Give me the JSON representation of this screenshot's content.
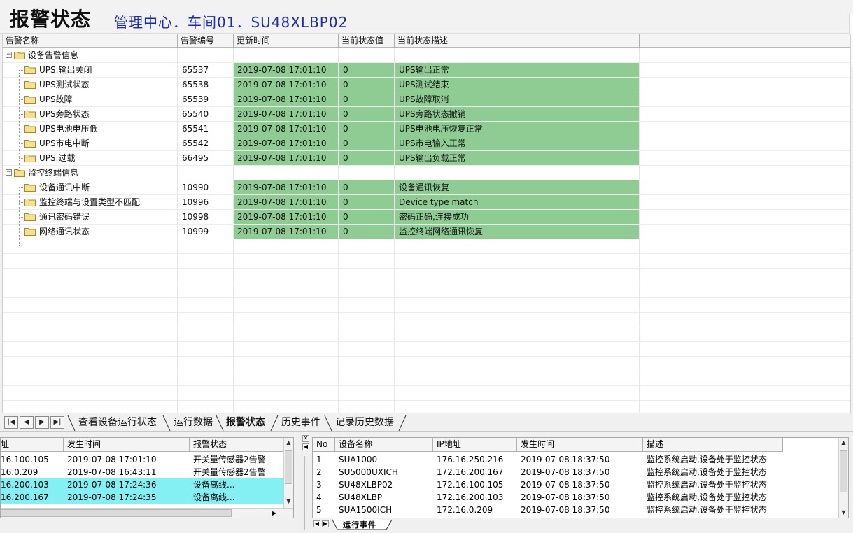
{
  "header": {
    "title": "报警状态",
    "path": "管理中心．车间01．SU48XLBP02"
  },
  "table": {
    "columns": [
      "告警名称",
      "告警编号",
      "更新时间",
      "当前状态值",
      "当前状态描述"
    ],
    "groups": [
      {
        "name": "设备告警信息",
        "rows": [
          {
            "name": "UPS.输出关闭",
            "code": "65537",
            "time": "2019-07-08 17:01:10",
            "value": "0",
            "desc": "UPS输出正常"
          },
          {
            "name": "UPS测试状态",
            "code": "65538",
            "time": "2019-07-08 17:01:10",
            "value": "0",
            "desc": "UPS测试结束"
          },
          {
            "name": "UPS故障",
            "code": "65539",
            "time": "2019-07-08 17:01:10",
            "value": "0",
            "desc": "UPS故障取消"
          },
          {
            "name": "UPS旁路状态",
            "code": "65540",
            "time": "2019-07-08 17:01:10",
            "value": "0",
            "desc": "UPS旁路状态撤销"
          },
          {
            "name": "UPS电池电压低",
            "code": "65541",
            "time": "2019-07-08 17:01:10",
            "value": "0",
            "desc": "UPS电池电压恢复正常"
          },
          {
            "name": "UPS市电中断",
            "code": "65542",
            "time": "2019-07-08 17:01:10",
            "value": "0",
            "desc": "UPS市电输入正常"
          },
          {
            "name": "UPS.过载",
            "code": "66495",
            "time": "2019-07-08 17:01:10",
            "value": "0",
            "desc": "UPS输出负载正常"
          }
        ]
      },
      {
        "name": "监控终端信息",
        "rows": [
          {
            "name": "设备通讯中断",
            "code": "10990",
            "time": "2019-07-08 17:01:10",
            "value": "0",
            "desc": "设备通讯恢复"
          },
          {
            "name": "监控终端与设置类型不匹配",
            "code": "10996",
            "time": "2019-07-08 17:01:10",
            "value": "0",
            "desc": "Device type match"
          },
          {
            "name": "通讯密码错误",
            "code": "10998",
            "time": "2019-07-08 17:01:10",
            "value": "0",
            "desc": "密码正确,连接成功"
          },
          {
            "name": "网络通讯状态",
            "code": "10999",
            "time": "2019-07-08 17:01:10",
            "value": "0",
            "desc": "监控终端网络通讯恢复"
          }
        ]
      }
    ],
    "status_color": "#8fcc94"
  },
  "tabs": {
    "nav": [
      "first-icon",
      "prev-icon",
      "next-icon",
      "last-icon"
    ],
    "items": [
      "查看设备运行状态",
      "运行数据",
      "报警状态",
      "历史事件",
      "记录历史数据"
    ],
    "active": "报警状态"
  },
  "alarms_panel": {
    "columns": [
      "址",
      "发生时间",
      "报警状态"
    ],
    "rows": [
      {
        "ip": "16.100.105",
        "time": "2019-07-08 17:01:10",
        "status": "开关量传感器2告警",
        "highlight": false
      },
      {
        "ip": "16.0.209",
        "time": "2019-07-08 16:43:11",
        "status": "开关量传感器2告警",
        "highlight": false
      },
      {
        "ip": "16.200.103",
        "time": "2019-07-08 17:24:36",
        "status": "设备离线...",
        "highlight": true
      },
      {
        "ip": "16.200.167",
        "time": "2019-07-08 17:24:35",
        "status": "设备离线...",
        "highlight": true
      }
    ],
    "highlight_color": "#85f0f4"
  },
  "events_panel": {
    "columns": [
      "No",
      "设备名称",
      "IP地址",
      "发生时间",
      "描述"
    ],
    "rows": [
      {
        "no": "1",
        "device": "SUA1000",
        "ip": "176.16.250.216",
        "time": "2019-07-08 18:37:50",
        "desc": "监控系统启动,设备处于监控状态"
      },
      {
        "no": "2",
        "device": "SU5000UXICH",
        "ip": "172.16.200.167",
        "time": "2019-07-08 18:37:50",
        "desc": "监控系统启动,设备处于监控状态"
      },
      {
        "no": "3",
        "device": "SU48XLBP02",
        "ip": "172.16.100.105",
        "time": "2019-07-08 18:37:50",
        "desc": "监控系统启动,设备处于监控状态"
      },
      {
        "no": "4",
        "device": "SU48XLBP",
        "ip": "172.16.200.103",
        "time": "2019-07-08 18:37:50",
        "desc": "监控系统启动,设备处于监控状态"
      },
      {
        "no": "5",
        "device": "SUA1500ICH",
        "ip": "172.16.0.209",
        "time": "2019-07-08 18:37:50",
        "desc": "监控系统启动,设备处于监控状态"
      }
    ],
    "tab_label": "运行事件"
  }
}
